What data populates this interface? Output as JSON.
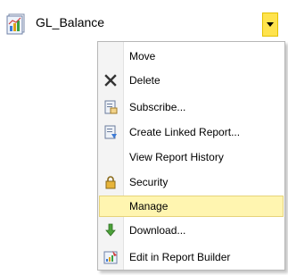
{
  "report": {
    "title": "GL_Balance",
    "icon": "report-icon"
  },
  "dropdown": {
    "icon": "chevron-down-icon",
    "color": "#ffe34d"
  },
  "menu": {
    "highlight_color": "#fff5b0",
    "items": [
      {
        "label": "Move",
        "icon": null
      },
      {
        "label": "Delete",
        "icon": "delete-x-icon"
      },
      {
        "label": "Subscribe...",
        "icon": "subscribe-icon"
      },
      {
        "label": "Create Linked Report...",
        "icon": "linked-report-icon"
      },
      {
        "label": "View Report History",
        "icon": null
      },
      {
        "label": "Security",
        "icon": "lock-icon"
      },
      {
        "label": "Manage",
        "icon": null,
        "highlighted": true
      },
      {
        "label": "Download...",
        "icon": "download-arrow-icon"
      },
      {
        "label": "Edit in Report Builder",
        "icon": "report-builder-icon"
      }
    ]
  }
}
